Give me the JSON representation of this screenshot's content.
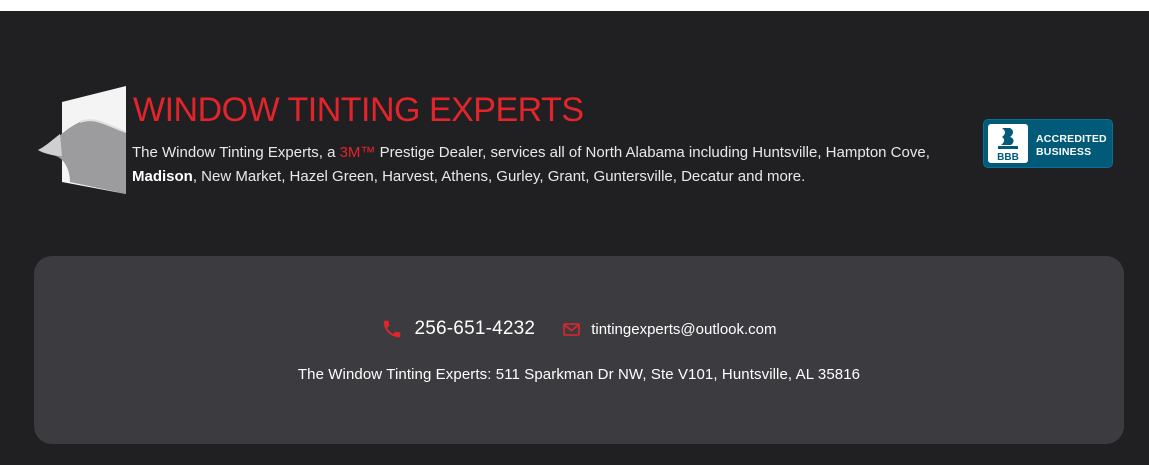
{
  "header": {
    "brand_title": "WINDOW TINTING EXPERTS",
    "intro_prefix": "The Window Tinting Experts, a ",
    "intro_3m": "3M™",
    "intro_middle": " Prestige Dealer, services all of North Alabama including Huntsville, Hampton Cove, ",
    "intro_madison": "Madison",
    "intro_suffix": ", New Market, Hazel Green, Harvest, Athens, Gurley, Grant, Guntersville, Decatur and more."
  },
  "badge": {
    "seal_text": "BBB",
    "line1": "ACCREDITED",
    "line2": "BUSINESS"
  },
  "contact": {
    "phone": "256-651-4232",
    "email": "tintingexperts@outlook.com",
    "address": "The Window Tinting Experts: 511 Sparkman Dr NW, Ste V101, Huntsville, AL 35816"
  },
  "colors": {
    "accent_red": "#e3242b",
    "background": "#202023",
    "card": "#3c3c40",
    "bbb_blue": "#005a78"
  },
  "icons": {
    "logo": "window-film-logo-icon",
    "phone": "phone-icon",
    "email": "envelope-icon",
    "bbb": "bbb-torch-icon"
  }
}
